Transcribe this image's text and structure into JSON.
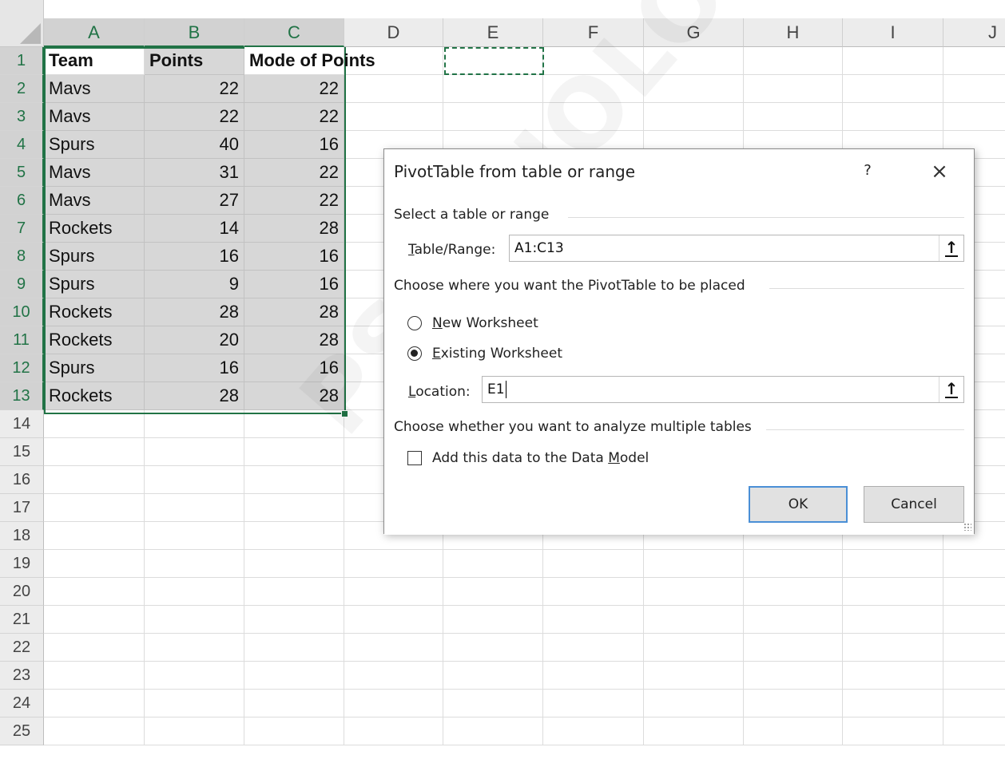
{
  "columns": [
    "A",
    "B",
    "C",
    "D",
    "E",
    "F",
    "G",
    "H",
    "I",
    "J"
  ],
  "rows": [
    "1",
    "2",
    "3",
    "4",
    "5",
    "6",
    "7",
    "8",
    "9",
    "10",
    "11",
    "12",
    "13",
    "14",
    "15",
    "16",
    "17",
    "18",
    "19",
    "20",
    "21",
    "22",
    "23",
    "24",
    "25"
  ],
  "table": {
    "headers": [
      "Team",
      "Points",
      "Mode of Points"
    ],
    "data": [
      [
        "Mavs",
        "22",
        "22"
      ],
      [
        "Mavs",
        "22",
        "22"
      ],
      [
        "Spurs",
        "40",
        "16"
      ],
      [
        "Mavs",
        "31",
        "22"
      ],
      [
        "Mavs",
        "27",
        "22"
      ],
      [
        "Rockets",
        "14",
        "28"
      ],
      [
        "Spurs",
        "16",
        "16"
      ],
      [
        "Spurs",
        "9",
        "16"
      ],
      [
        "Rockets",
        "28",
        "28"
      ],
      [
        "Rockets",
        "20",
        "28"
      ],
      [
        "Spurs",
        "16",
        "16"
      ],
      [
        "Rockets",
        "28",
        "28"
      ]
    ]
  },
  "dialog": {
    "title": "PivotTable from table or range",
    "help": "?",
    "close": "×",
    "section_select": "Select a table or range",
    "table_range_label_accel": "T",
    "table_range_label_rest": "able/Range:",
    "table_range_value": "A1:C13",
    "section_place": "Choose where you want the PivotTable to be placed",
    "new_ws_accel": "N",
    "new_ws_rest": "ew Worksheet",
    "existing_ws_accel": "E",
    "existing_ws_rest": "xisting Worksheet",
    "location_label_accel": "L",
    "location_label_rest": "ocation:",
    "location_value": "E1",
    "section_multi": "Choose whether you want to analyze multiple tables",
    "data_model_pre": "Add this data to the Data ",
    "data_model_accel": "M",
    "data_model_rest": "odel",
    "ok": "OK",
    "cancel": "Cancel",
    "collapse_icon": "↑"
  },
  "watermark": "PSYCHOLOGY.COM",
  "colors": {
    "accent": "#217346",
    "selection_shade": "#d7d7d7",
    "ok_border": "#4a8fd6"
  }
}
